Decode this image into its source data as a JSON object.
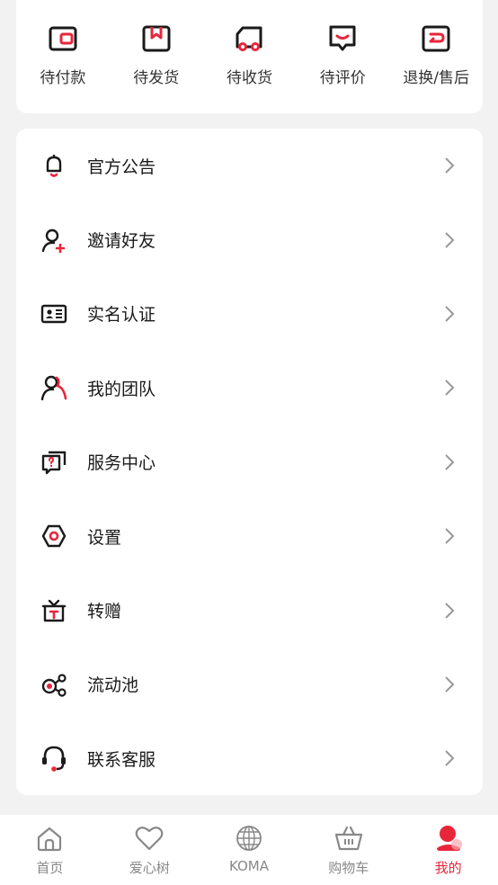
{
  "colors": {
    "accent": "#e8263a",
    "text": "#1a1a1a",
    "muted": "#888888"
  },
  "orders": [
    {
      "label": "待付款",
      "icon": "wallet-icon"
    },
    {
      "label": "待发货",
      "icon": "package-icon"
    },
    {
      "label": "待收货",
      "icon": "truck-icon"
    },
    {
      "label": "待评价",
      "icon": "comment-icon"
    },
    {
      "label": "退换/售后",
      "icon": "return-icon"
    }
  ],
  "menu": [
    {
      "label": "官方公告",
      "icon": "bell-icon"
    },
    {
      "label": "邀请好友",
      "icon": "add-user-icon"
    },
    {
      "label": "实名认证",
      "icon": "id-card-icon"
    },
    {
      "label": "我的团队",
      "icon": "team-icon"
    },
    {
      "label": "服务中心",
      "icon": "help-center-icon"
    },
    {
      "label": "设置",
      "icon": "settings-icon"
    },
    {
      "label": "转赠",
      "icon": "gift-icon"
    },
    {
      "label": "流动池",
      "icon": "pool-icon"
    },
    {
      "label": "联系客服",
      "icon": "headset-icon"
    }
  ],
  "tabs": [
    {
      "label": "首页",
      "icon": "home-icon"
    },
    {
      "label": "爱心树",
      "icon": "heart-icon"
    },
    {
      "label": "KOMA",
      "icon": "globe-icon"
    },
    {
      "label": "购物车",
      "icon": "basket-icon"
    },
    {
      "label": "我的",
      "icon": "profile-icon",
      "active": true
    }
  ]
}
